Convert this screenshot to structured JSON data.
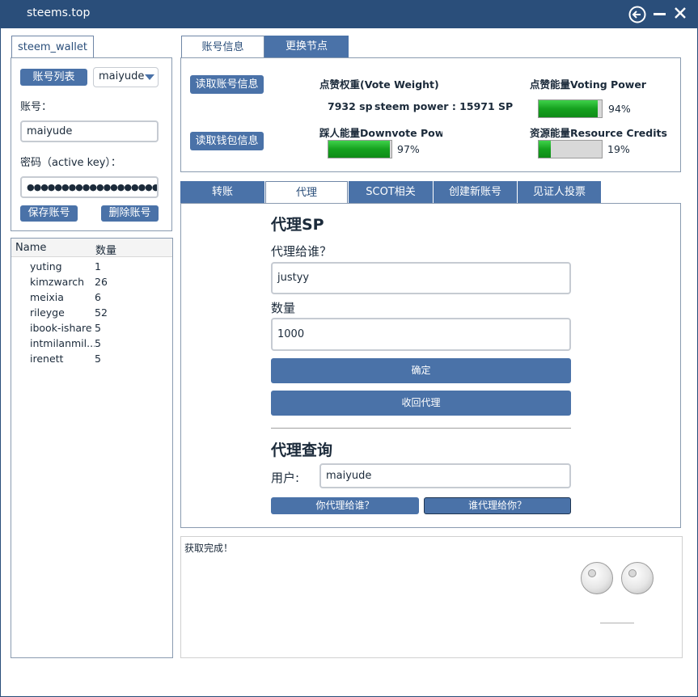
{
  "window": {
    "title": "steems.top"
  },
  "left": {
    "wallet_tab": "steem_wallet",
    "account_list_button": "账号列表",
    "account_select_value": "maiyude",
    "account_label": "账号：",
    "account_value": "maiyude",
    "password_label": "密码（active key）：",
    "password_value": "●●●●●●●●●●●●●●●●●●●●",
    "save_button": "保存账号",
    "delete_button": "删除账号",
    "list_headers": {
      "name": "Name",
      "count": "数量"
    },
    "list_rows": [
      {
        "name": "yuting",
        "count": "1"
      },
      {
        "name": "kimzwarch",
        "count": "26"
      },
      {
        "name": "meixia",
        "count": "6"
      },
      {
        "name": "rileyge",
        "count": "52"
      },
      {
        "name": "ibook-ishare",
        "count": "5"
      },
      {
        "name": "intmilanmil...",
        "count": "5"
      },
      {
        "name": "irenett",
        "count": "5"
      }
    ]
  },
  "top_tabs": [
    "账号信息",
    "更换节点"
  ],
  "info": {
    "read_account_button": "读取账号信息",
    "read_wallet_button": "读取钱包信息",
    "vote_weight_label": "点赞权重(Vote Weight)",
    "sp_value": "7932 sp",
    "steem_power_text": "steem power : 15971 SP",
    "voting_power_label": "点赞能量Voting Power",
    "voting_power_percent": 94,
    "voting_power_text": "94%",
    "downvote_label": "踩人能量Downvote Power",
    "downvote_percent": 97,
    "downvote_text": "97%",
    "rc_label": "资源能量Resource Credits",
    "rc_percent": 19,
    "rc_text": "19%"
  },
  "func_tabs": [
    "转账",
    "代理",
    "SCOT相关",
    "创建新账号",
    "见证人投票"
  ],
  "delegate": {
    "title": "代理SP",
    "to_label": "代理给谁？",
    "to_value": "justyy",
    "amount_label": "数量",
    "amount_value": "1000",
    "confirm_button": "确定",
    "undelegate_button": "收回代理",
    "query_title": "代理查询",
    "user_label": "用户:",
    "user_value": "maiyude",
    "query_out_button": "你代理给谁？",
    "query_in_button": "谁代理给你？"
  },
  "log": {
    "text": "获取完成！"
  },
  "colors": {
    "titlebar": "#2a4e7a",
    "button": "#4a72a8",
    "progress_green": "#16a11f"
  }
}
